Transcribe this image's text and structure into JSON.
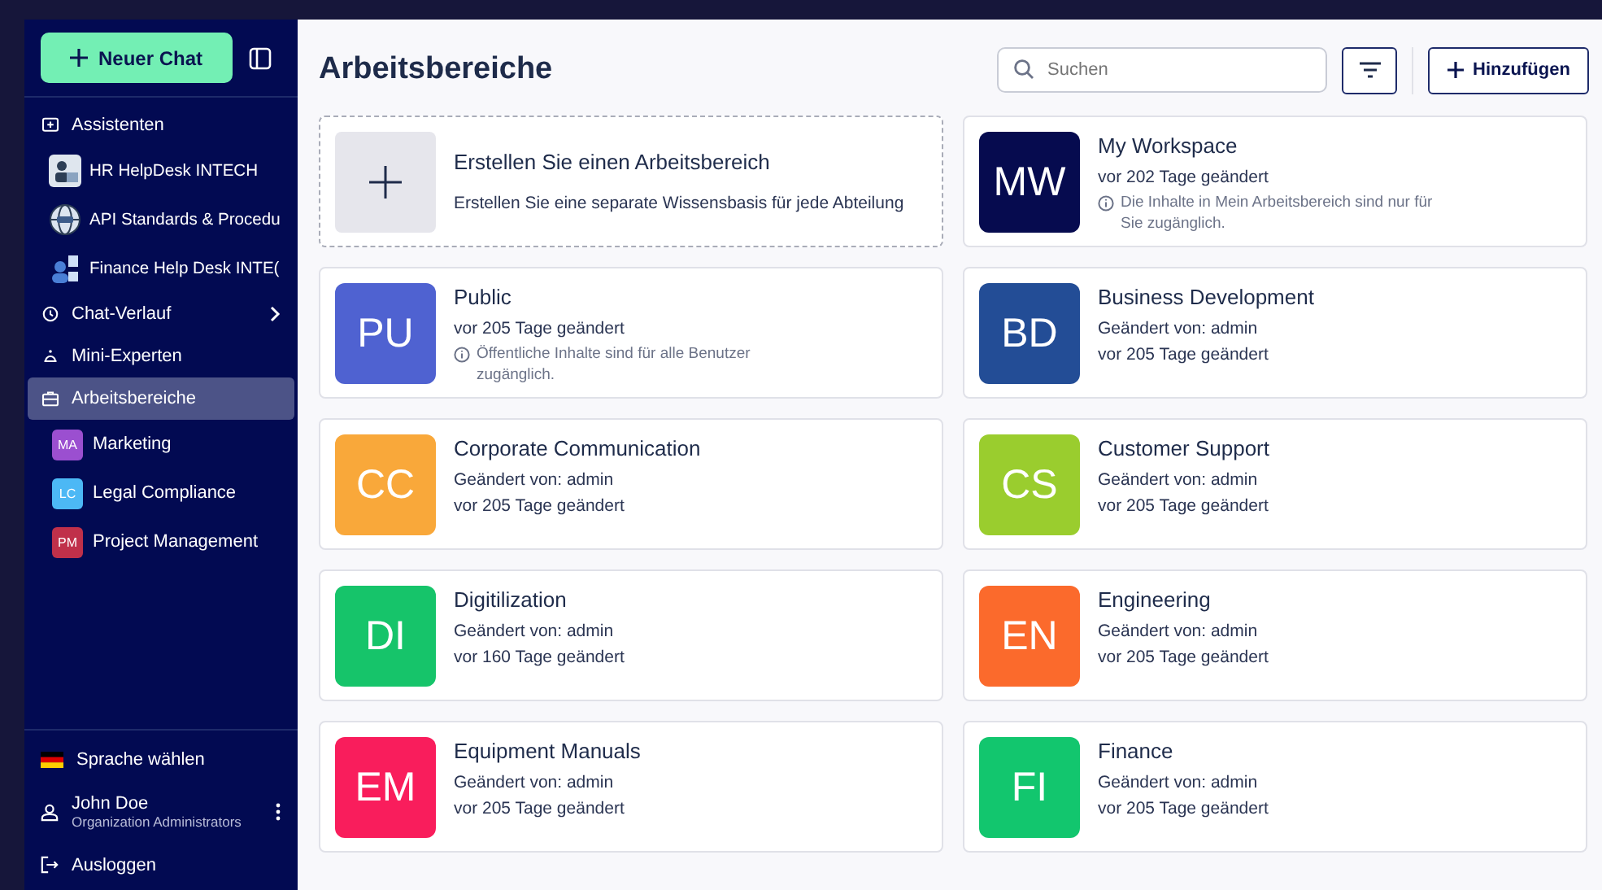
{
  "sidebar": {
    "new_chat": "Neuer Chat",
    "items": [
      {
        "kind": "section",
        "label": "Assistenten",
        "selected": false,
        "chevron": false
      },
      {
        "kind": "assistant",
        "label": "HR HelpDesk INTECH",
        "selected": false
      },
      {
        "kind": "assistant",
        "label": "API Standards & Procedu",
        "selected": false
      },
      {
        "kind": "assistant",
        "label": "Finance Help Desk INTE(",
        "selected": false
      },
      {
        "kind": "section",
        "label": "Chat-Verlauf",
        "selected": false,
        "chevron": true
      },
      {
        "kind": "section",
        "label": "Mini-Experten",
        "selected": false,
        "chevron": false
      },
      {
        "kind": "section",
        "label": "Arbeitsbereiche",
        "selected": true,
        "chevron": false
      },
      {
        "kind": "workspace",
        "badge": "MA",
        "color": "#9b4fd0",
        "label": "Marketing",
        "selected": false
      },
      {
        "kind": "workspace",
        "badge": "LC",
        "color": "#4cb8f5",
        "label": "Legal Compliance",
        "selected": false
      },
      {
        "kind": "workspace",
        "badge": "PM",
        "color": "#c0304a",
        "label": "Project Management",
        "selected": false
      }
    ],
    "language": "Sprache wählen",
    "user": {
      "name": "John Doe",
      "role": "Organization Administrators"
    },
    "logout": "Ausloggen"
  },
  "header": {
    "title": "Arbeitsbereiche",
    "search": {
      "placeholder": "Suchen"
    },
    "add_button": "Hinzufügen"
  },
  "cards": [
    {
      "kind": "create",
      "title": "Erstellen Sie einen Arbeitsbereich",
      "lines": [
        "Erstellen Sie eine separate Wissensbasis für jede Abteilung"
      ]
    },
    {
      "kind": "workspace",
      "initials": "MW",
      "color": "#060b4f",
      "title": "My Workspace",
      "lines": [
        "vor 202 Tage geändert"
      ],
      "note": "Die Inhalte in Mein Arbeitsbereich sind nur für Sie zugänglich."
    },
    {
      "kind": "workspace",
      "initials": "PU",
      "color": "#4f62d1",
      "title": "Public",
      "lines": [
        "vor 205 Tage geändert"
      ],
      "note": "Öffentliche Inhalte sind für alle Benutzer zugänglich."
    },
    {
      "kind": "workspace",
      "initials": "BD",
      "color": "#234d96",
      "title": "Business Development",
      "lines": [
        "Geändert von: admin",
        "vor 205 Tage geändert"
      ]
    },
    {
      "kind": "workspace",
      "initials": "CC",
      "color": "#f9a83a",
      "title": "Corporate Communication",
      "lines": [
        "Geändert von: admin",
        "vor 205 Tage geändert"
      ]
    },
    {
      "kind": "workspace",
      "initials": "CS",
      "color": "#9acd2e",
      "title": "Customer Support",
      "lines": [
        "Geändert von: admin",
        "vor 205 Tage geändert"
      ]
    },
    {
      "kind": "workspace",
      "initials": "DI",
      "color": "#16c46a",
      "title": "Digitilization",
      "lines": [
        "Geändert von: admin",
        "vor 160 Tage geändert"
      ]
    },
    {
      "kind": "workspace",
      "initials": "EN",
      "color": "#fb6a2c",
      "title": "Engineering",
      "lines": [
        "Geändert von: admin",
        "vor 205 Tage geändert"
      ]
    },
    {
      "kind": "workspace",
      "initials": "EM",
      "color": "#f91d5c",
      "title": "Equipment Manuals",
      "lines": [
        "Geändert von: admin",
        "vor 205 Tage geändert"
      ]
    },
    {
      "kind": "workspace",
      "initials": "FI",
      "color": "#12c66e",
      "title": "Finance",
      "lines": [
        "Geändert von: admin",
        "vor 205 Tage geändert"
      ]
    }
  ]
}
